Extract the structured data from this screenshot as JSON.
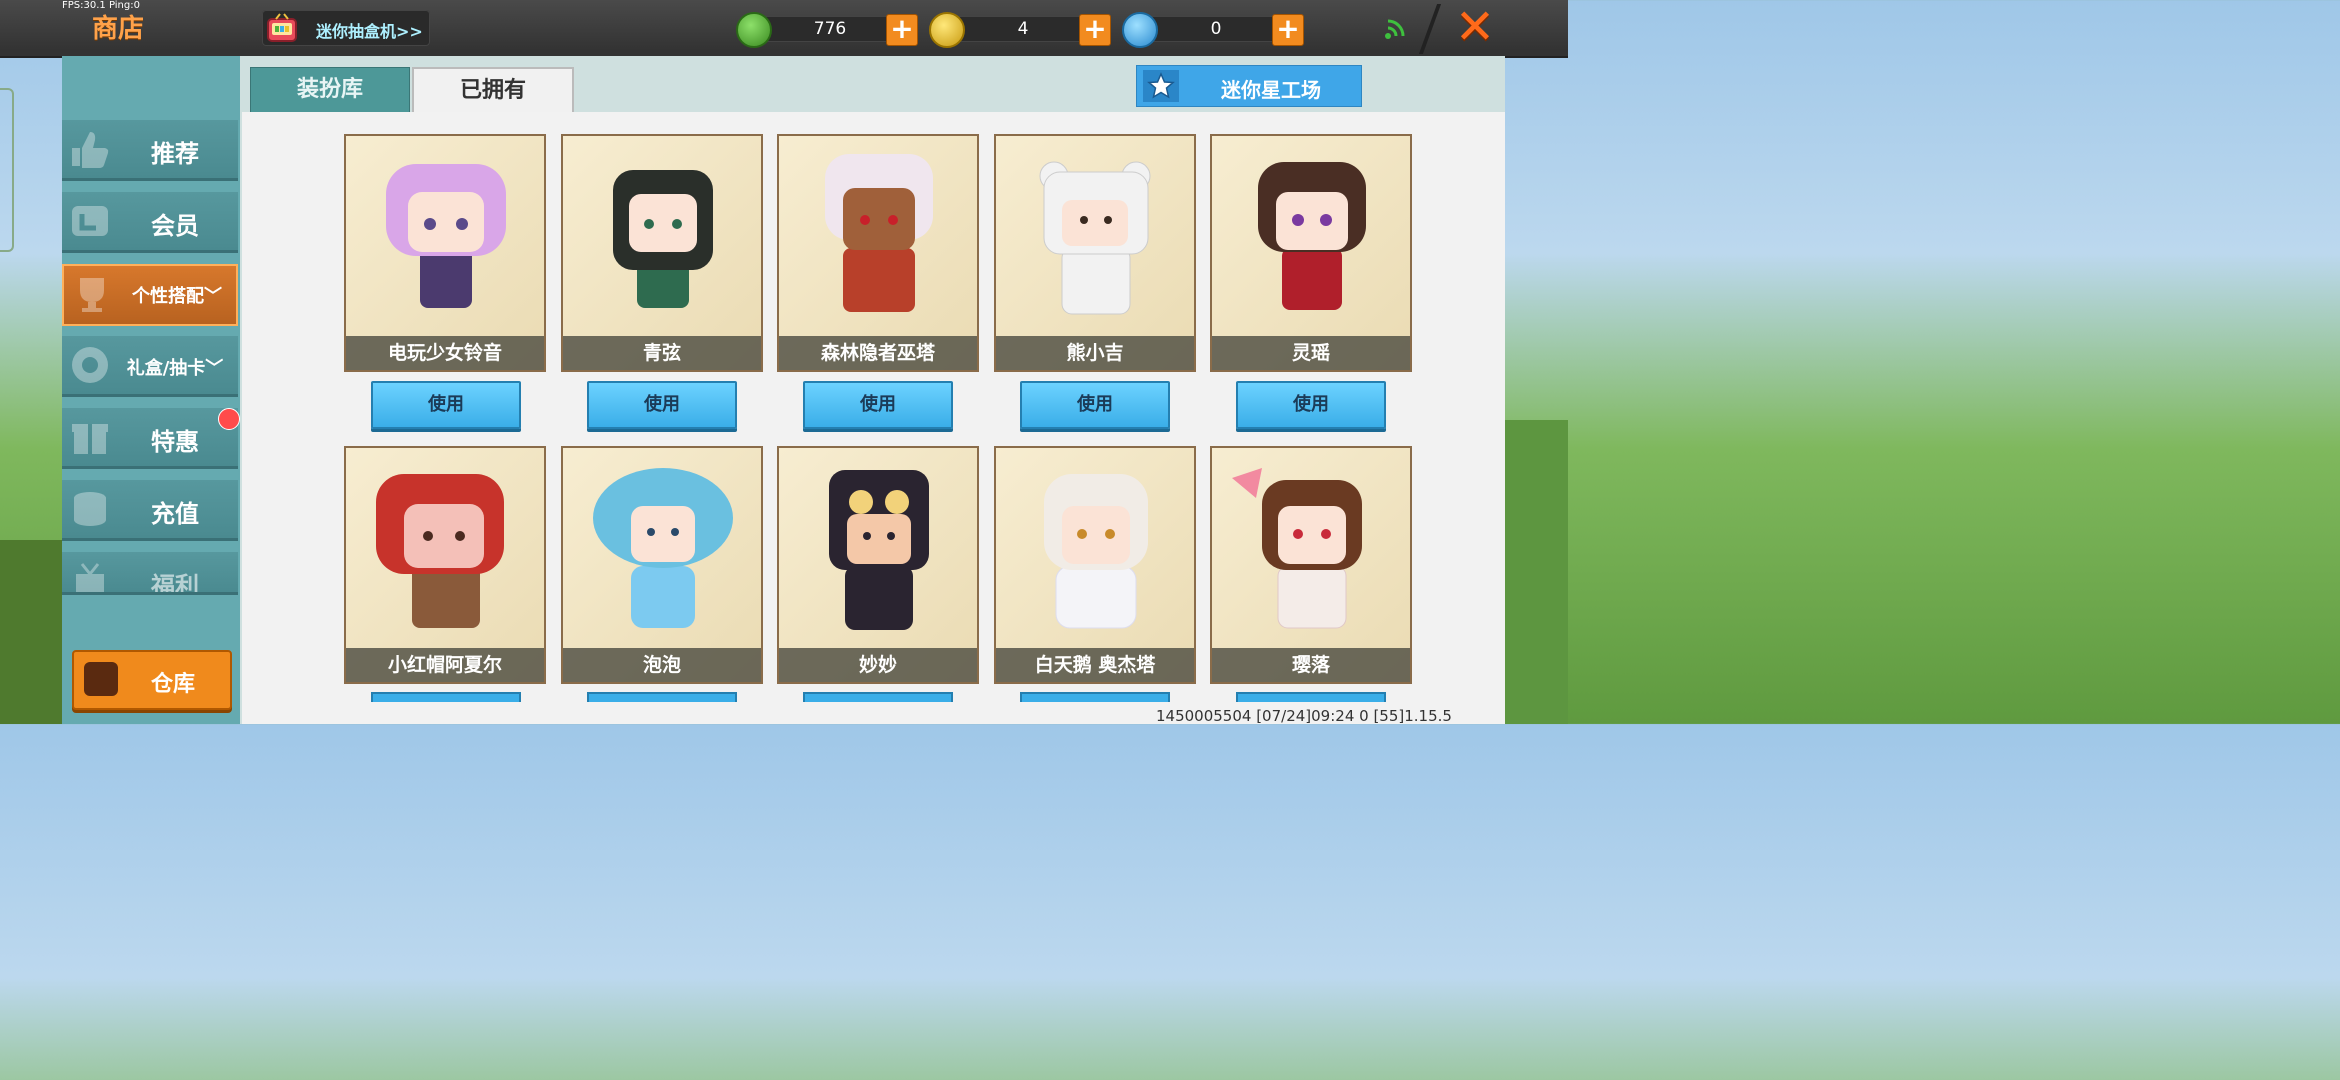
{
  "status": {
    "fps": "FPS:30.1  Ping:0"
  },
  "header": {
    "title": "商店",
    "gacha_label": "迷你抽盒机>>",
    "currencies": [
      {
        "name": "mini-bean",
        "value": "776",
        "color": "#4fb33a"
      },
      {
        "name": "mini-coin",
        "value": "4",
        "color": "#e8c22a"
      },
      {
        "name": "mini-point",
        "value": "0",
        "color": "#3ab0e8"
      }
    ]
  },
  "sidebar": {
    "items": [
      {
        "label": "推荐",
        "icon": "thumbs-up-icon"
      },
      {
        "label": "会员",
        "icon": "vip-icon"
      },
      {
        "label": "个性搭配",
        "icon": "trophy-icon",
        "active": true,
        "chevron": "﹀"
      },
      {
        "label": "礼盒/抽卡",
        "icon": "disc-icon",
        "chevron": "﹀"
      },
      {
        "label": "特惠",
        "icon": "gift-icon"
      },
      {
        "label": "充值",
        "icon": "coin-stack-icon"
      },
      {
        "label": "福利",
        "icon": "present-icon"
      }
    ],
    "warehouse": "仓库"
  },
  "tabs": [
    {
      "label": "装扮库"
    },
    {
      "label": "已拥有",
      "active": true
    }
  ],
  "star_workshop": "迷你星工场",
  "characters_row1": [
    {
      "name": "电玩少女铃音",
      "use": "使用",
      "hair": "#d9a6e8",
      "outfit": "#4b3a6e"
    },
    {
      "name": "青弦",
      "use": "使用",
      "hair": "#2a2f2a",
      "outfit": "#2e6b4f"
    },
    {
      "name": "森林隐者巫塔",
      "use": "使用",
      "hair": "#f0e6ee",
      "outfit": "#b8402a"
    },
    {
      "name": "熊小吉",
      "use": "使用",
      "hair": "#f2f2f2",
      "outfit": "#f2f2f2"
    },
    {
      "name": "灵瑶",
      "use": "使用",
      "hair": "#4a2e24",
      "outfit": "#b01f2b"
    }
  ],
  "characters_row2": [
    {
      "name": "小红帽阿夏尔",
      "hair": "#c7332b",
      "outfit": "#8a5a3a"
    },
    {
      "name": "泡泡",
      "hair": "#6ac0e0",
      "outfit": "#7ccaf0"
    },
    {
      "name": "妙妙",
      "hair": "#2a2430",
      "outfit": "#2a2430"
    },
    {
      "name": "白天鹅 奥杰塔",
      "hair": "#f1ece6",
      "outfit": "#f4f4f8"
    },
    {
      "name": "璎落",
      "hair": "#6a3a22",
      "outfit": "#f4ece8"
    }
  ],
  "footer": "1450005504   [07/24]09:24 0 [55]1.15.5"
}
